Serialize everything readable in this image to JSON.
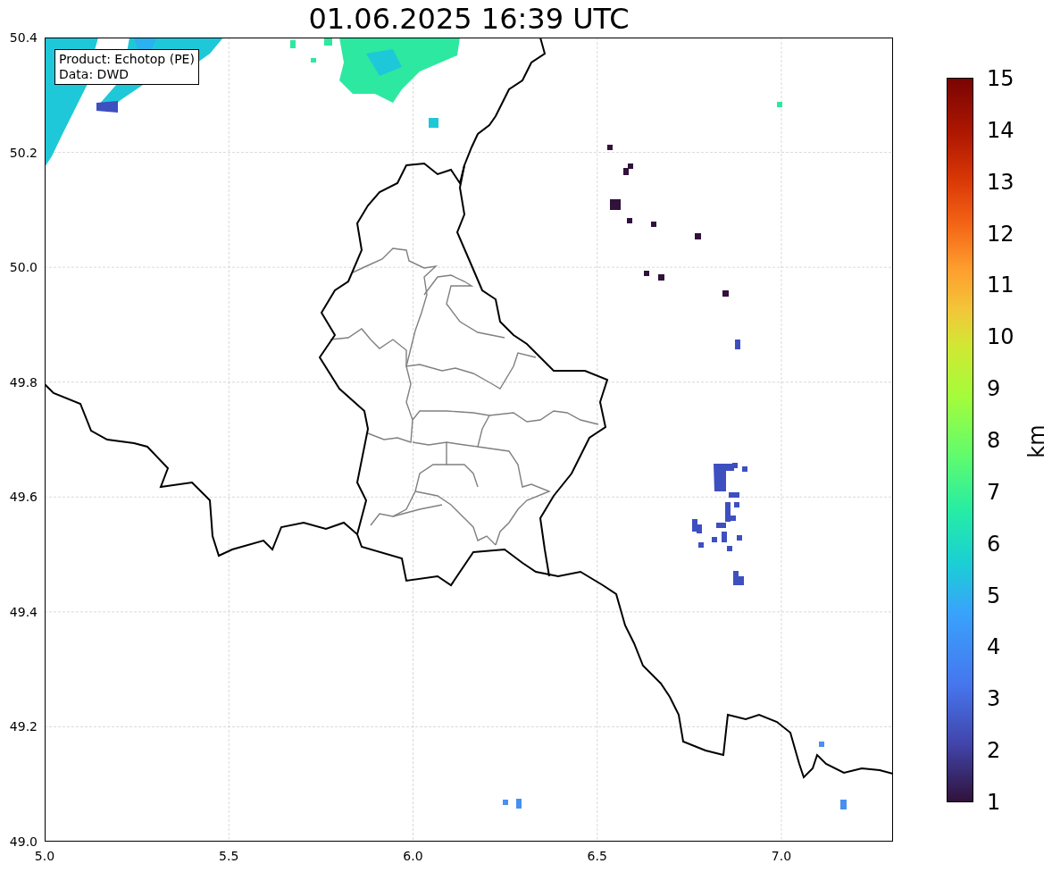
{
  "title": "01.06.2025 16:39 UTC",
  "info_box": {
    "lines": [
      "Product: Echotop (PE)",
      "Data: DWD"
    ]
  },
  "x_axis": {
    "ticks": [
      "5.0",
      "5.5",
      "6.0",
      "6.5",
      "7.0"
    ]
  },
  "y_axis": {
    "ticks": [
      "50.4",
      "50.2",
      "50.0",
      "49.8",
      "49.6",
      "49.4",
      "49.2",
      "49.0"
    ]
  },
  "colorbar": {
    "label": "km",
    "ticks": [
      "15",
      "14",
      "13",
      "12",
      "11",
      "10",
      "9",
      "8",
      "7",
      "6",
      "5",
      "4",
      "3",
      "2",
      "1"
    ]
  }
}
